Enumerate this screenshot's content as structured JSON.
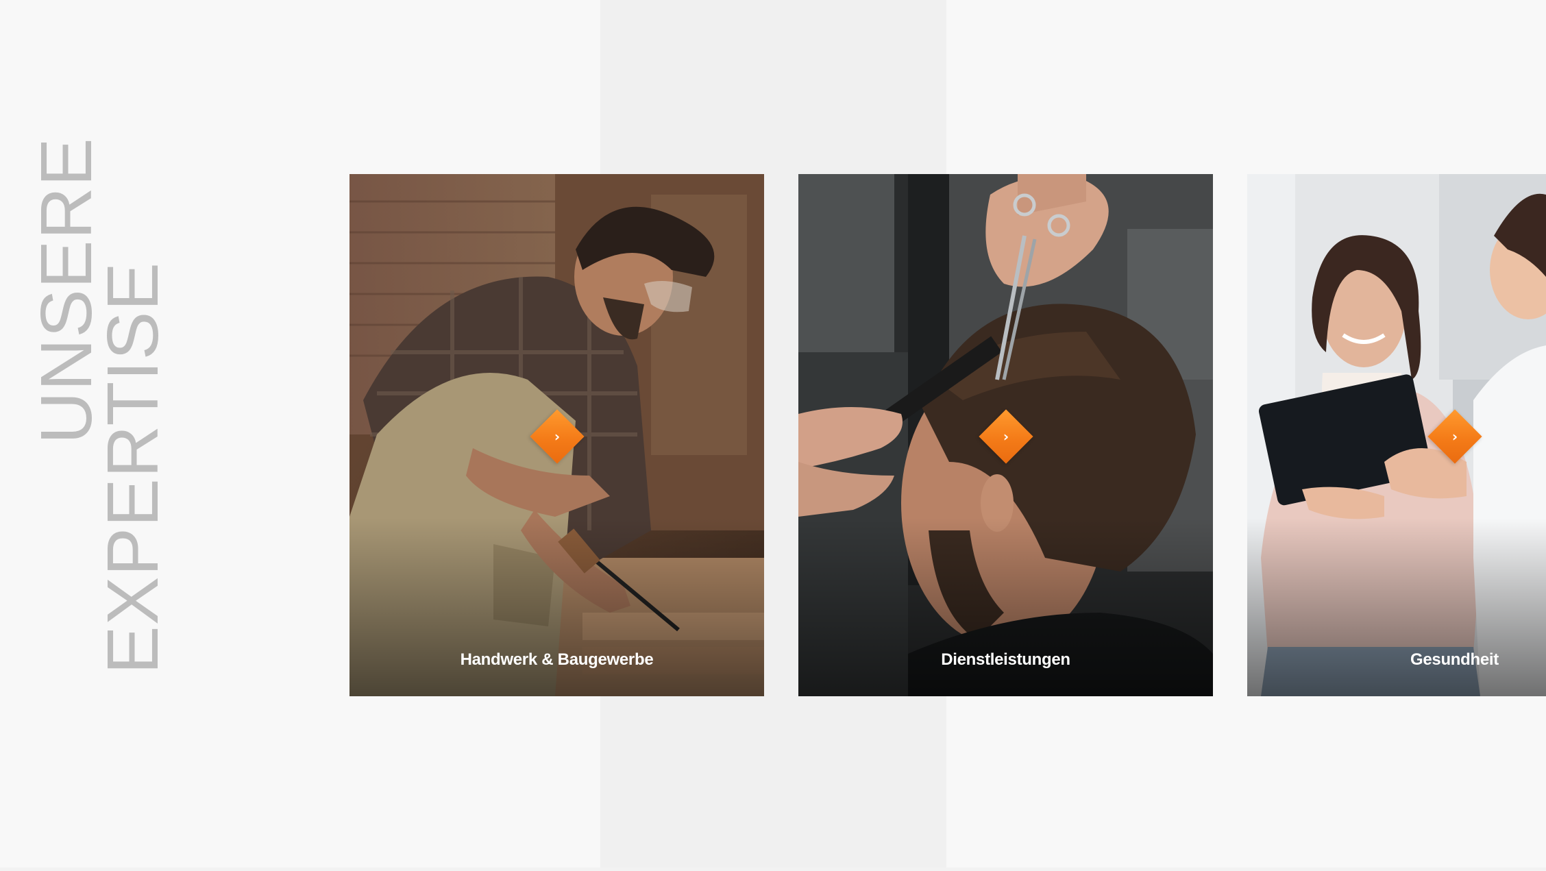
{
  "heading": {
    "line1": "UNSERE",
    "line2": "EXPERTISE"
  },
  "colors": {
    "accent": "#f47b18",
    "heading_text": "#bcbcbc",
    "background": "#f8f8f8",
    "center_band": "#f0f0f0"
  },
  "cards": [
    {
      "label": "Handwerk & Baugewerbe",
      "icon": "chevron-right-icon",
      "image": "carpenter-chiseling-wood-photo"
    },
    {
      "label": "Dienstleistungen",
      "icon": "chevron-right-icon",
      "image": "barber-cutting-hair-photo"
    },
    {
      "label": "Gesundheit",
      "icon": "chevron-right-icon",
      "image": "doctor-patient-tablet-photo"
    }
  ]
}
